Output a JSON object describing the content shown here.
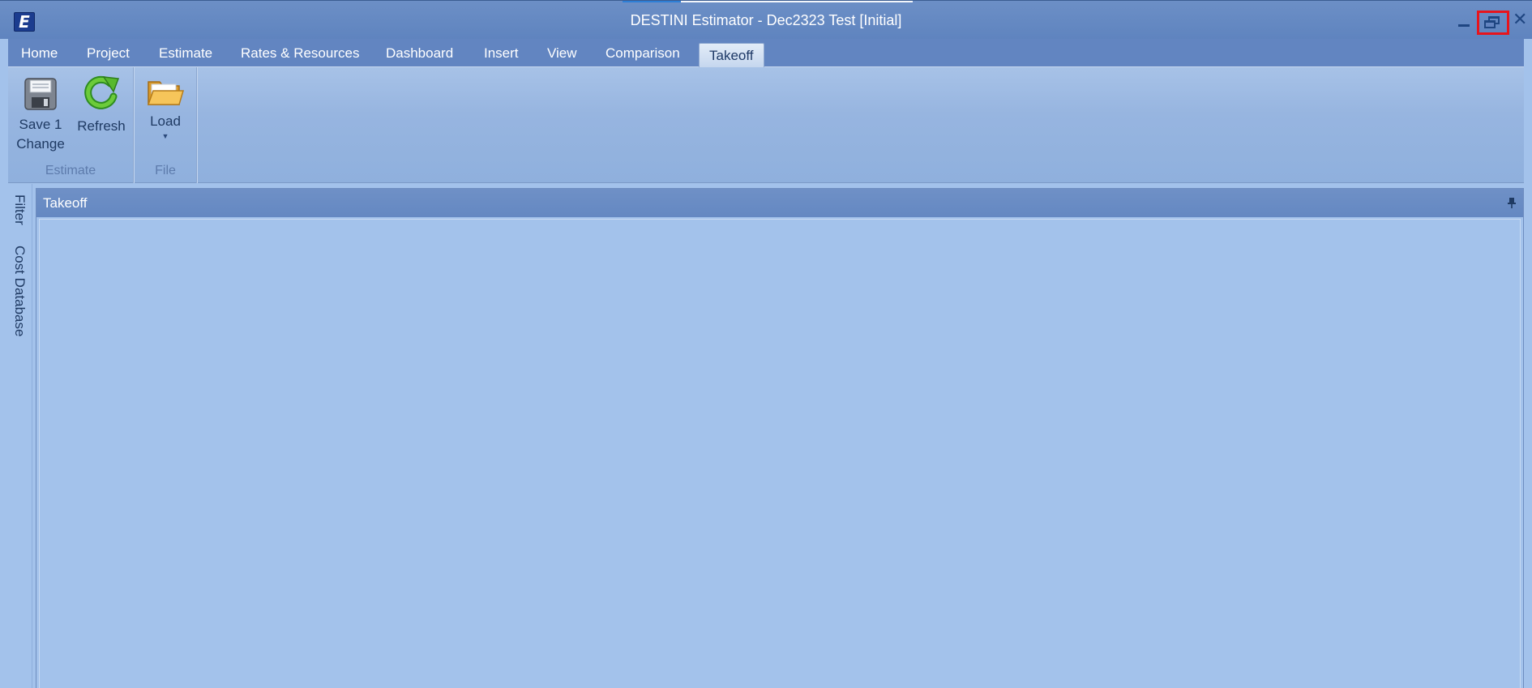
{
  "window": {
    "title": "DESTINI Estimator - Dec2323 Test [Initial]",
    "logo_letter": "E"
  },
  "tabs": [
    {
      "label": "Home"
    },
    {
      "label": "Project"
    },
    {
      "label": "Estimate"
    },
    {
      "label": "Rates & Resources"
    },
    {
      "label": "Dashboard"
    },
    {
      "label": "Insert"
    },
    {
      "label": "View"
    },
    {
      "label": "Comparison"
    },
    {
      "label": "Takeoff",
      "active": true
    }
  ],
  "ribbon": {
    "groups": [
      {
        "label": "Estimate",
        "buttons": [
          {
            "label_line1": "Save 1",
            "label_line2": "Change",
            "icon": "floppy-disk-icon"
          },
          {
            "label_line1": "Refresh",
            "icon": "refresh-icon"
          }
        ]
      },
      {
        "label": "File",
        "buttons": [
          {
            "label_line1": "Load",
            "icon": "folder-icon",
            "has_dropdown": true
          }
        ]
      }
    ]
  },
  "side_tabs": [
    {
      "label": "Filter"
    },
    {
      "label": "Cost Database"
    }
  ],
  "panel": {
    "title": "Takeoff"
  },
  "colors": {
    "annotation": "#e8141c",
    "titlebar": "#6285c1",
    "workspace": "#a3c2eb"
  }
}
